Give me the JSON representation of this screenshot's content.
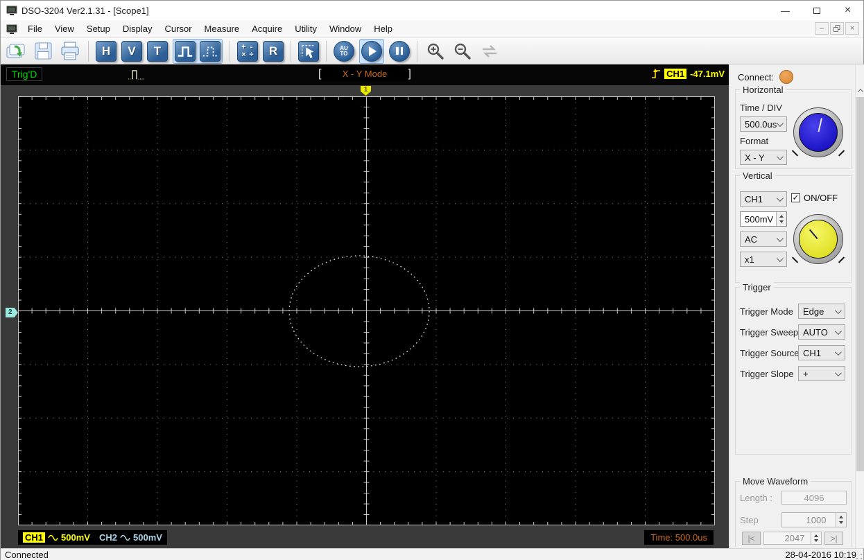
{
  "window_title": "DSO-3204 Ver2.1.31 - [Scope1]",
  "menubar": {
    "items": [
      "File",
      "View",
      "Setup",
      "Display",
      "Cursor",
      "Measure",
      "Acquire",
      "Utility",
      "Window",
      "Help"
    ]
  },
  "toolbar": {
    "h_label": "H",
    "v_label": "V",
    "t_label": "T",
    "r_label": "R",
    "auto_line1": "AU",
    "auto_line2": "TO",
    "math_symbols": [
      "+",
      "-",
      "×",
      "÷"
    ]
  },
  "scope": {
    "trig_status": "Trig'D",
    "mode_left_bracket": "[",
    "mode_label": "X - Y Mode",
    "mode_right_bracket": "]",
    "trigger_channel": "CH1",
    "trigger_level": "-47.1mV",
    "marker_top": "1",
    "marker_left": "2",
    "ch1_label": "CH1",
    "ch1_scale": "500mV",
    "ch2_label": "CH2",
    "ch2_scale": "500mV",
    "time_readout": "Time: 500.0us",
    "waveform": {
      "type": "xy_lissajous_ellipse",
      "cx": 0.4896,
      "cy": 0.5008,
      "rx": 0.1005,
      "ry": 0.1292
    }
  },
  "panel": {
    "connect_label": "Connect:",
    "horizontal": {
      "title": "Horizontal",
      "time_div_label": "Time / DIV",
      "time_div_value": "500.0us",
      "format_label": "Format",
      "format_value": "X - Y"
    },
    "vertical": {
      "title": "Vertical",
      "channel_value": "CH1",
      "onoff_label": "ON/OFF",
      "onoff_checked": "✓",
      "scale_value": "500mV",
      "coupling_value": "AC",
      "probe_value": "x1"
    },
    "trigger": {
      "title": "Trigger",
      "rows": [
        {
          "label": "Trigger Mode",
          "value": "Edge"
        },
        {
          "label": "Trigger Sweep",
          "value": "AUTO"
        },
        {
          "label": "Trigger Source",
          "value": "CH1"
        },
        {
          "label": "Trigger Slope",
          "value": "+"
        }
      ]
    },
    "move_waveform": {
      "title": "Move Waveform",
      "length_label": "Length :",
      "length_value": "4096",
      "step_label": "Step",
      "step_value": "1000",
      "position_value": "2047",
      "first_button": "|<",
      "last_button": ">|"
    }
  },
  "statusbar": {
    "connection_status": "Connected",
    "datetime": "28-04-2016  10:19"
  },
  "icons": {
    "open": "folder-open-green-arrow",
    "save": "floppy-disk",
    "print": "printer",
    "pulse_solid": "square-wave",
    "pulse_dashed": "dashed-square-wave",
    "math": "arithmetic-operators",
    "cursor": "cursor-measure-arrow",
    "auto": "auto-setup",
    "play": "run-acquisition",
    "pause": "pause-acquisition",
    "zoom_in": "magnifier-plus",
    "zoom_out": "magnifier-minus",
    "sync": "sync-arrows-disabled",
    "connect": "connection-indicator-dot",
    "trigger_edge": "rising-edge-trigger",
    "pulse_status": "pulse-waveform",
    "ac_sine": "sine-coupling"
  },
  "colors": {
    "ch1": "#ffff00",
    "ch2": "#a9d7e6",
    "trig_text": "#00dd00",
    "mode_text": "#c96a1b",
    "time_text": "#c96a1b",
    "connect_dot": "#e0913d",
    "knob_horizontal": "#2a1fd8",
    "knob_vertical": "#e8e838",
    "toolbar_blue": "#35689e"
  }
}
